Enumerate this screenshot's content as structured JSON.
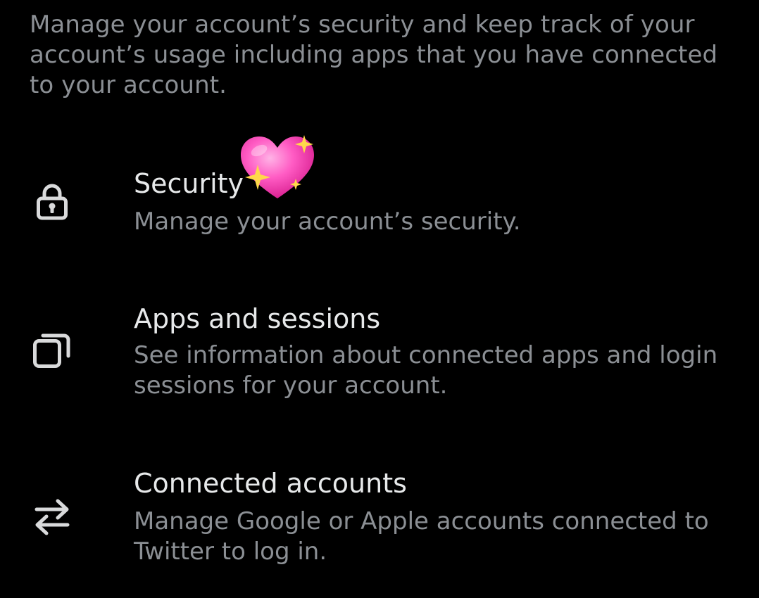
{
  "intro": {
    "text": "Manage your account’s security and keep track of your account’s usage including apps that you have connected to your account."
  },
  "items": [
    {
      "icon": "lock-icon",
      "title": "Security",
      "description": "Manage your account’s security."
    },
    {
      "icon": "stacked-windows-icon",
      "title": "Apps and sessions",
      "description": "See information about connected apps and login sessions for your account."
    },
    {
      "icon": "swap-arrows-icon",
      "title": "Connected accounts",
      "description": "Manage Google or Apple accounts connected to Twitter to log in."
    }
  ],
  "decoration": {
    "sticker": "sparkling-heart-icon"
  },
  "colors": {
    "background": "#000000",
    "title_text": "#e7e9ea",
    "secondary_text": "#8b8f94",
    "icon": "#d9dadb",
    "heart": "#ff4fb8"
  }
}
